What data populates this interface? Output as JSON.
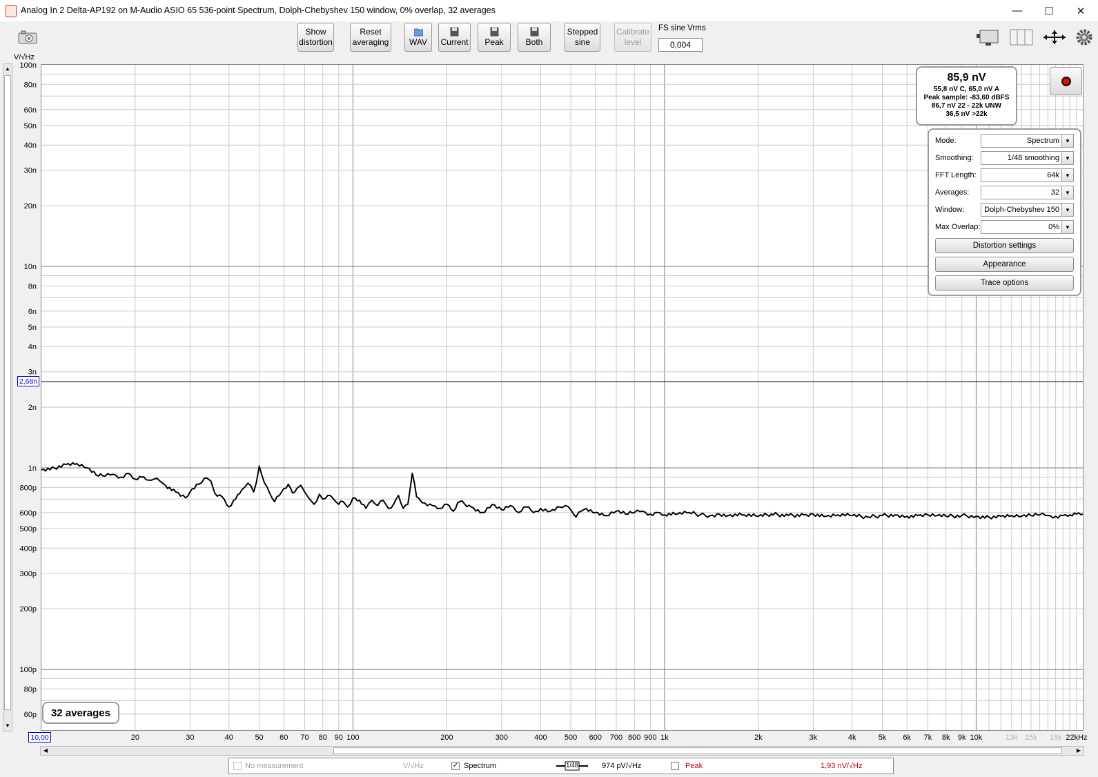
{
  "window": {
    "title": "Analog In 2 Delta-AP192 on M-Audio ASIO 65 536-point Spectrum, Dolph-Chebyshev 150 window, 0% overlap, 32 averages",
    "minimize": "—",
    "maximize": "☐",
    "close": "✕"
  },
  "toolbar": {
    "show_distortion": [
      "Show",
      "distortion"
    ],
    "reset_averaging": [
      "Reset",
      "averaging"
    ],
    "wav": "WAV",
    "current": "Current",
    "peak": "Peak",
    "both": "Both",
    "stepped_sine": [
      "Stepped",
      "sine"
    ],
    "calibrate_level": [
      "Calibrate",
      "level"
    ],
    "fs_label": "FS sine Vrms",
    "fs_value": "0,004"
  },
  "plot": {
    "y_unit": "V/√Hz",
    "y_marker": "2,68n",
    "x_start_box": "10,00",
    "averages_badge": "32 averages"
  },
  "readout": {
    "main": "85,9 nV",
    "line1": "55,8 nV C, 65,0 nV A",
    "line2": "Peak sample: -83,60 dBFS",
    "line3": "86,7 nV 22 - 22k UNW",
    "line4": "36,5 nV >22k"
  },
  "settings": {
    "rows": [
      {
        "label": "Mode:",
        "value": "Spectrum"
      },
      {
        "label": "Smoothing:",
        "value": "1/48 smoothing"
      },
      {
        "label": "FFT Length:",
        "value": "64k"
      },
      {
        "label": "Averages:",
        "value": "32"
      },
      {
        "label": "Window:",
        "value": "Dolph-Chebyshev 150"
      },
      {
        "label": "Max Overlap:",
        "value": "0%"
      }
    ],
    "distortion_settings": "Distortion settings",
    "appearance": "Appearance",
    "trace_options": "Trace options"
  },
  "legend": {
    "no_measurement": "No measurement",
    "unit": "V/√Hz",
    "spectrum": "Spectrum",
    "smoothing": "1/48",
    "spectrum_value": "974 pV/√Hz",
    "peak": "Peak",
    "peak_value": "1,93 nV/√Hz"
  },
  "colors": {
    "trace": "#000000",
    "peak_text": "#c00000",
    "marker_box": "#0000cc"
  },
  "chart_data": {
    "type": "line",
    "x_scale": "log",
    "y_scale": "log",
    "xlim": [
      10,
      22000
    ],
    "ylim": [
      5e-11,
      1e-07
    ],
    "grid": true,
    "x_tick_labels": [
      {
        "v": 20,
        "t": "20"
      },
      {
        "v": 30,
        "t": "30"
      },
      {
        "v": 40,
        "t": "40"
      },
      {
        "v": 50,
        "t": "50"
      },
      {
        "v": 60,
        "t": "60"
      },
      {
        "v": 70,
        "t": "70"
      },
      {
        "v": 80,
        "t": "80"
      },
      {
        "v": 90,
        "t": "90"
      },
      {
        "v": 100,
        "t": "100"
      },
      {
        "v": 200,
        "t": "200"
      },
      {
        "v": 300,
        "t": "300"
      },
      {
        "v": 400,
        "t": "400"
      },
      {
        "v": 500,
        "t": "500"
      },
      {
        "v": 600,
        "t": "600"
      },
      {
        "v": 700,
        "t": "700"
      },
      {
        "v": 800,
        "t": "800"
      },
      {
        "v": 900,
        "t": "900"
      },
      {
        "v": 1000,
        "t": "1k"
      },
      {
        "v": 2000,
        "t": "2k"
      },
      {
        "v": 3000,
        "t": "3k"
      },
      {
        "v": 4000,
        "t": "4k"
      },
      {
        "v": 5000,
        "t": "5k"
      },
      {
        "v": 6000,
        "t": "6k"
      },
      {
        "v": 7000,
        "t": "7k"
      },
      {
        "v": 8000,
        "t": "8k"
      },
      {
        "v": 9000,
        "t": "9k"
      },
      {
        "v": 10000,
        "t": "10k"
      },
      {
        "v": 13000,
        "t": "13k",
        "faded": true
      },
      {
        "v": 15000,
        "t": "15k",
        "faded": true
      },
      {
        "v": 18000,
        "t": "18k",
        "faded": true
      },
      {
        "v": 22000,
        "t": "22kHz"
      }
    ],
    "y_tick_labels": [
      {
        "v": 1e-07,
        "t": "100n"
      },
      {
        "v": 8e-08,
        "t": "80n"
      },
      {
        "v": 6e-08,
        "t": "60n"
      },
      {
        "v": 5e-08,
        "t": "50n"
      },
      {
        "v": 4e-08,
        "t": "40n"
      },
      {
        "v": 3e-08,
        "t": "30n"
      },
      {
        "v": 2e-08,
        "t": "20n"
      },
      {
        "v": 1e-08,
        "t": "10n"
      },
      {
        "v": 8e-09,
        "t": "8n"
      },
      {
        "v": 6e-09,
        "t": "6n"
      },
      {
        "v": 5e-09,
        "t": "5n"
      },
      {
        "v": 4e-09,
        "t": "4n"
      },
      {
        "v": 3e-09,
        "t": "3n"
      },
      {
        "v": 2e-09,
        "t": "2n"
      },
      {
        "v": 1e-09,
        "t": "1n"
      },
      {
        "v": 8e-10,
        "t": "800p"
      },
      {
        "v": 6e-10,
        "t": "600p"
      },
      {
        "v": 5e-10,
        "t": "500p"
      },
      {
        "v": 4e-10,
        "t": "400p"
      },
      {
        "v": 3e-10,
        "t": "300p"
      },
      {
        "v": 2e-10,
        "t": "200p"
      },
      {
        "v": 1e-10,
        "t": "100p"
      },
      {
        "v": 8e-11,
        "t": "80p"
      },
      {
        "v": 6e-11,
        "t": "60p"
      }
    ],
    "marker_level": 2.68e-09,
    "series": [
      {
        "x": [
          10,
          11,
          12,
          13,
          14,
          15,
          16,
          17,
          18,
          19,
          20,
          21,
          22,
          23,
          24,
          25,
          27,
          29,
          30,
          32,
          34,
          35,
          36,
          38,
          40,
          42,
          44,
          46,
          48,
          49,
          50,
          51,
          52,
          54,
          56,
          58,
          60,
          62,
          64,
          66,
          68,
          70,
          72,
          75,
          78,
          80,
          83,
          86,
          90,
          93,
          96,
          100,
          105,
          110,
          115,
          120,
          125,
          130,
          135,
          140,
          145,
          150,
          155,
          160,
          170,
          180,
          190,
          200,
          210,
          220,
          240,
          260,
          280,
          300,
          320,
          340,
          360,
          380,
          400,
          430,
          460,
          480,
          500,
          520,
          540,
          560,
          600,
          650,
          700,
          750,
          800,
          850,
          900,
          950,
          1000,
          1100,
          1200,
          1300,
          1400,
          1500,
          1600,
          1800,
          2000,
          2200,
          2500,
          2800,
          3000,
          3300,
          3600,
          4000,
          4500,
          5000,
          5500,
          6000,
          6500,
          7000,
          7500,
          8000,
          9000,
          10000,
          11000,
          12000,
          13000,
          14000,
          15000,
          16000,
          17000,
          18000,
          19000,
          20000,
          21000,
          22000
        ],
        "y": [
          9.8e-10,
          1e-09,
          1.04e-09,
          1.05e-09,
          1e-09,
          9.2e-10,
          9.1e-10,
          9.3e-10,
          9e-10,
          9.4e-10,
          8.8e-10,
          9e-10,
          8.7e-10,
          8.8e-10,
          8.6e-10,
          8.2e-10,
          7.6e-10,
          7.1e-10,
          7.6e-10,
          8.3e-10,
          8.9e-10,
          8.6e-10,
          7.5e-10,
          7.2e-10,
          6.4e-10,
          7e-10,
          7.8e-10,
          8.4e-10,
          7.6e-10,
          8.5e-10,
          1.02e-09,
          9.2e-10,
          8.4e-10,
          7.5e-10,
          6.8e-10,
          7.3e-10,
          7.9e-10,
          8.3e-10,
          7.5e-10,
          7.9e-10,
          8.2e-10,
          7.6e-10,
          7.1e-10,
          6.6e-10,
          7.4e-10,
          7e-10,
          7.3e-10,
          7.1e-10,
          6.6e-10,
          6.8e-10,
          6.4e-10,
          7.1e-10,
          6.9e-10,
          6.3e-10,
          6.9e-10,
          6.5e-10,
          6.9e-10,
          6.3e-10,
          6.6e-10,
          7.3e-10,
          6.3e-10,
          6.6e-10,
          9.4e-10,
          7.2e-10,
          6.7e-10,
          6.5e-10,
          6.3e-10,
          6.6e-10,
          6.1e-10,
          6.8e-10,
          6.4e-10,
          6e-10,
          6.6e-10,
          6.2e-10,
          6.5e-10,
          6e-10,
          6.4e-10,
          6e-10,
          6.3e-10,
          6.1e-10,
          6.4e-10,
          6.5e-10,
          6.2e-10,
          5.7e-10,
          6.1e-10,
          6.3e-10,
          6e-10,
          5.8e-10,
          6.1e-10,
          5.9e-10,
          6e-10,
          6.1e-10,
          5.9e-10,
          6e-10,
          5.85e-10,
          5.9e-10,
          6e-10,
          5.85e-10,
          5.8e-10,
          5.9e-10,
          5.8e-10,
          5.85e-10,
          5.75e-10,
          5.9e-10,
          5.8e-10,
          5.85e-10,
          5.9e-10,
          5.75e-10,
          5.85e-10,
          5.8e-10,
          5.7e-10,
          5.8e-10,
          5.85e-10,
          5.75e-10,
          5.8e-10,
          5.85e-10,
          5.8e-10,
          5.75e-10,
          5.8e-10,
          5.75e-10,
          5.7e-10,
          5.75e-10,
          5.8e-10,
          5.75e-10,
          5.8e-10,
          5.85e-10,
          5.8e-10,
          5.75e-10,
          5.8e-10,
          5.85e-10,
          5.9e-10,
          5.9e-10
        ]
      }
    ]
  }
}
